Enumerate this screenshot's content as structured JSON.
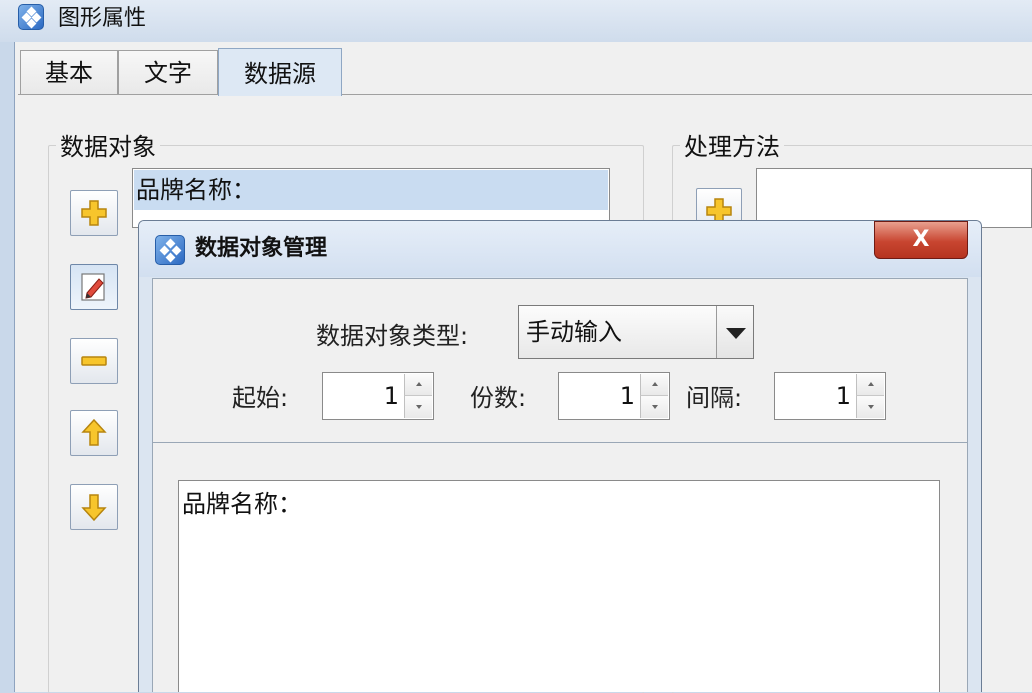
{
  "main_window": {
    "title": "图形属性",
    "tabs": [
      {
        "label": "基本"
      },
      {
        "label": "文字"
      },
      {
        "label": "数据源",
        "active": true
      }
    ],
    "data_object_group": {
      "label": "数据对象",
      "toolbar_icons": [
        "plus-icon",
        "edit-icon",
        "minus-icon",
        "arrow-up-icon",
        "arrow-down-icon"
      ],
      "items": [
        {
          "label": "品牌名称："
        }
      ]
    },
    "method_group": {
      "label": "处理方法"
    }
  },
  "dialog": {
    "title": "数据对象管理",
    "close_label": "X",
    "type_label": "数据对象类型:",
    "type_value": "手动输入",
    "start_label": "起始:",
    "start_value": "1",
    "copies_label": "份数:",
    "copies_value": "1",
    "interval_label": "间隔:",
    "interval_value": "1",
    "content": "品牌名称："
  },
  "colors": {
    "title_bar": "#d6e2f0",
    "selection": "#c9dcf1",
    "close_button": "#c84530",
    "icon_yellow": "#f7c52c"
  }
}
